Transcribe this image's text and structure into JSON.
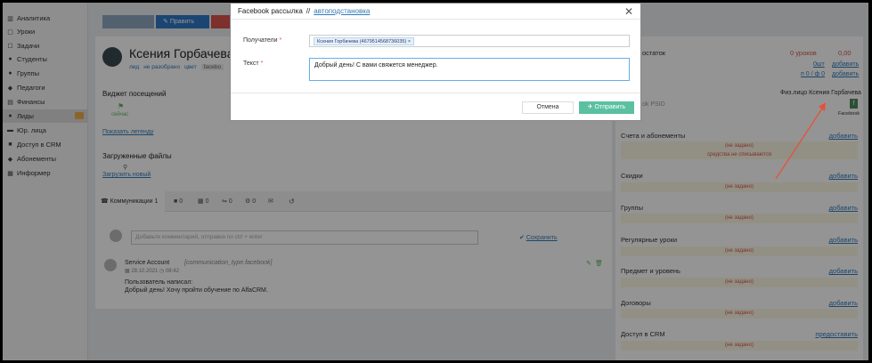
{
  "sidebar": {
    "items": [
      {
        "label": "Аналитика",
        "icon": "chart-icon"
      },
      {
        "label": "Уроки",
        "icon": "calendar-icon"
      },
      {
        "label": "Задачи",
        "icon": "tasks-icon"
      },
      {
        "label": "Студенты",
        "icon": "user-icon"
      },
      {
        "label": "Группы",
        "icon": "users-icon"
      },
      {
        "label": "Педагоги",
        "icon": "graduation-icon"
      },
      {
        "label": "Финансы",
        "icon": "money-icon"
      },
      {
        "label": "Лиды",
        "icon": "lead-icon"
      },
      {
        "label": "Юр. лица",
        "icon": "building-icon"
      },
      {
        "label": "Доступ в CRM",
        "icon": "lock-icon"
      },
      {
        "label": "Абонементы",
        "icon": "tag-icon"
      },
      {
        "label": "Информер",
        "icon": "info-icon"
      }
    ]
  },
  "toolbar": {
    "edit_label": "Править"
  },
  "profile": {
    "name": "Ксения Горбачева",
    "tags": [
      "лид",
      "не разобрано",
      "цвет",
      "facebo"
    ]
  },
  "visits": {
    "title": "Виджет посещений",
    "flag_label": "сейчас",
    "legend_link": "Показать легенду"
  },
  "files": {
    "title": "Загруженные файлы",
    "upload_link": "Загрузить новый"
  },
  "comm_tabs": [
    {
      "label": "Коммуникации 1",
      "icon": "phone-icon"
    },
    {
      "label": "0",
      "icon": "comment-icon"
    },
    {
      "label": "0",
      "icon": "calendar-icon"
    },
    {
      "label": "0",
      "icon": "sms-icon"
    },
    {
      "label": "0",
      "icon": "gear-icon"
    },
    {
      "label": "",
      "icon": "mail-icon"
    },
    {
      "label": "",
      "icon": "history-icon"
    }
  ],
  "comment": {
    "placeholder": "Добавьте комментарий, отправка по ctrl + enter",
    "save_label": "Сохранить"
  },
  "message": {
    "author": "Service Account",
    "type_tag": "[communication_type.facebook]",
    "date": "28.10.2021",
    "time": "08:42",
    "line1": "Пользователь написал:",
    "line2": "Добрый день! Хочу пройти обучение по AlfaCRM."
  },
  "right_panel": {
    "balance_label": "остаток",
    "balance_value": "0 уроков",
    "balance_money": "0,00",
    "paid_link": "0шт",
    "paid_add": "добавить",
    "ratio_link": "п 0 / ф 0",
    "ratio_add": "добавить",
    "person_type": "Физ.лицо",
    "person_name": "Ксения Горбачева",
    "psid_label": "ok PSID",
    "fb_button": "f",
    "fb_caption": "Facebook",
    "not_set": "(не задано)",
    "no_charge": "средства не списываются",
    "sections": [
      {
        "title": "Счета и абонементы",
        "link": "добавить"
      },
      {
        "title": "Скидки",
        "link": "добавить"
      },
      {
        "title": "Группы",
        "link": "добавить"
      },
      {
        "title": "Регулярные уроки",
        "link": "добавить"
      },
      {
        "title": "Предмет и уровень",
        "link": "добавить"
      },
      {
        "title": "Договоры",
        "link": "добавить"
      },
      {
        "title": "Доступ в CRM",
        "link": "предоставить"
      }
    ]
  },
  "modal": {
    "title": "Facebook рассылка",
    "separator": "//",
    "subtitle": "автоподстановка",
    "recipients_label": "Получатели",
    "recipient_tag": "Ксения Горбачева (4679514568736035) ×",
    "text_label": "Текст",
    "text_value": "Добрый день! С вами свяжется менеджер.",
    "cancel_label": "Отмена",
    "send_label": "Отправить"
  },
  "colors": {
    "accent": "#337ab7",
    "send": "#5bc0a0",
    "danger": "#d9534f",
    "arrow": "#e8503a"
  }
}
